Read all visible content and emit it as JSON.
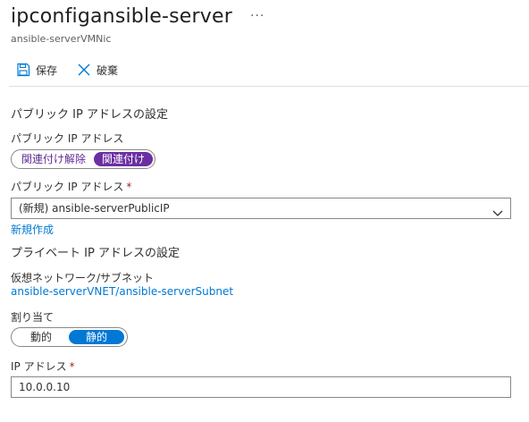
{
  "header": {
    "title": "ipconfigansible-server",
    "subtitle": "ansible-serverVMNic",
    "more_label": "···"
  },
  "toolbar": {
    "save_label": "保存",
    "discard_label": "破棄"
  },
  "public_ip_section": {
    "heading": "パブリック IP アドレスの設定",
    "toggle_label": "パブリック IP アドレス",
    "toggle_options": [
      "関連付け解除",
      "関連付け"
    ],
    "toggle_selected": "関連付け",
    "select_label": "パブリック IP アドレス",
    "required_mark": "*",
    "select_value": "(新規) ansible-serverPublicIP",
    "create_new_link": "新規作成"
  },
  "private_ip_section": {
    "heading": "プライベート IP アドレスの設定",
    "vnet_label": "仮想ネットワーク/サブネット",
    "vnet_link": "ansible-serverVNET/ansible-serverSubnet",
    "assignment_label": "割り当て",
    "assignment_options": [
      "動的",
      "静的"
    ],
    "assignment_selected": "静的",
    "ip_label": "IP アドレス",
    "required_mark": "*",
    "ip_value": "10.0.0.10"
  },
  "colors": {
    "accent": "#0078d4",
    "toggle_purple": "#6b2fa3",
    "required": "#a4262c"
  },
  "icons": [
    "save-icon",
    "discard-icon",
    "chevron-down-icon"
  ]
}
